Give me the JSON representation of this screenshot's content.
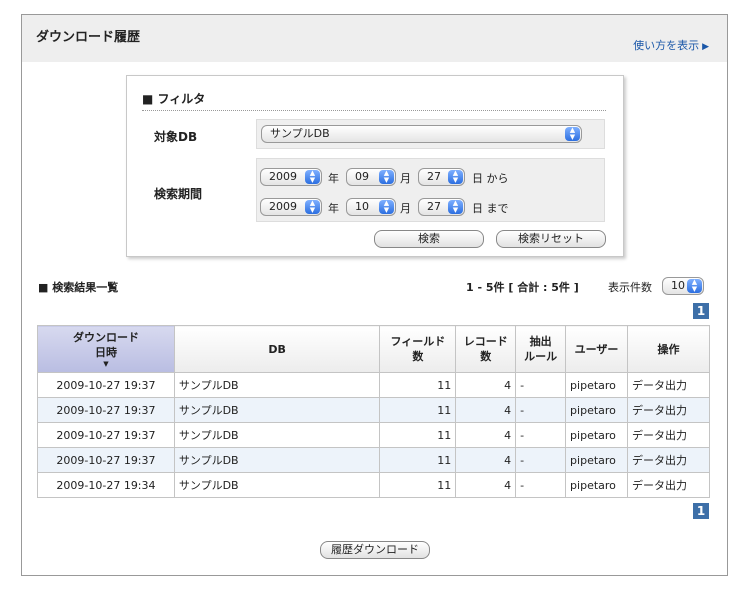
{
  "header": {
    "title": "ダウンロード履歴",
    "howto": "使い方を表示",
    "howto_icon": "triangle-right-icon"
  },
  "filter": {
    "heading": "■ フィルタ",
    "db_label": "対象DB",
    "db_value": "サンプルDB",
    "period_label": "検索期間",
    "from": {
      "year": "2009",
      "month": "09",
      "day": "27"
    },
    "to": {
      "year": "2009",
      "month": "10",
      "day": "27"
    },
    "year_unit": "年",
    "month_unit": "月",
    "from_suffix": "日 から",
    "to_suffix": "日 まで",
    "search_label": "検索",
    "reset_label": "検索リセット"
  },
  "results": {
    "title": "■ 検索結果一覧",
    "count": "1 - 5件 [ 合計 : 5件 ]",
    "perpage_label": "表示件数",
    "perpage_value": "10",
    "page": "1"
  },
  "table": {
    "headers": {
      "date_1": "ダウンロード",
      "date_2": "日時",
      "db": "DB",
      "fields_1": "フィールド",
      "fields_2": "数",
      "records_1": "レコード",
      "records_2": "数",
      "rule_1": "抽出",
      "rule_2": "ルール",
      "user": "ユーザー",
      "action": "操作"
    },
    "rows": [
      {
        "date": "2009-10-27 19:37",
        "db": "サンプルDB",
        "fields": "11",
        "records": "4",
        "rule": "-",
        "user": "pipetaro",
        "action": "データ出力"
      },
      {
        "date": "2009-10-27 19:37",
        "db": "サンプルDB",
        "fields": "11",
        "records": "4",
        "rule": "-",
        "user": "pipetaro",
        "action": "データ出力"
      },
      {
        "date": "2009-10-27 19:37",
        "db": "サンプルDB",
        "fields": "11",
        "records": "4",
        "rule": "-",
        "user": "pipetaro",
        "action": "データ出力"
      },
      {
        "date": "2009-10-27 19:37",
        "db": "サンプルDB",
        "fields": "11",
        "records": "4",
        "rule": "-",
        "user": "pipetaro",
        "action": "データ出力"
      },
      {
        "date": "2009-10-27 19:34",
        "db": "サンプルDB",
        "fields": "11",
        "records": "4",
        "rule": "-",
        "user": "pipetaro",
        "action": "データ出力"
      }
    ]
  },
  "footer": {
    "download_label": "履歴ダウンロード"
  },
  "colors": {
    "link": "#1a57a8",
    "page_badge": "#3d6fa8",
    "sorted_header": "#b9bde2",
    "row_alt": "#edf3fa"
  }
}
